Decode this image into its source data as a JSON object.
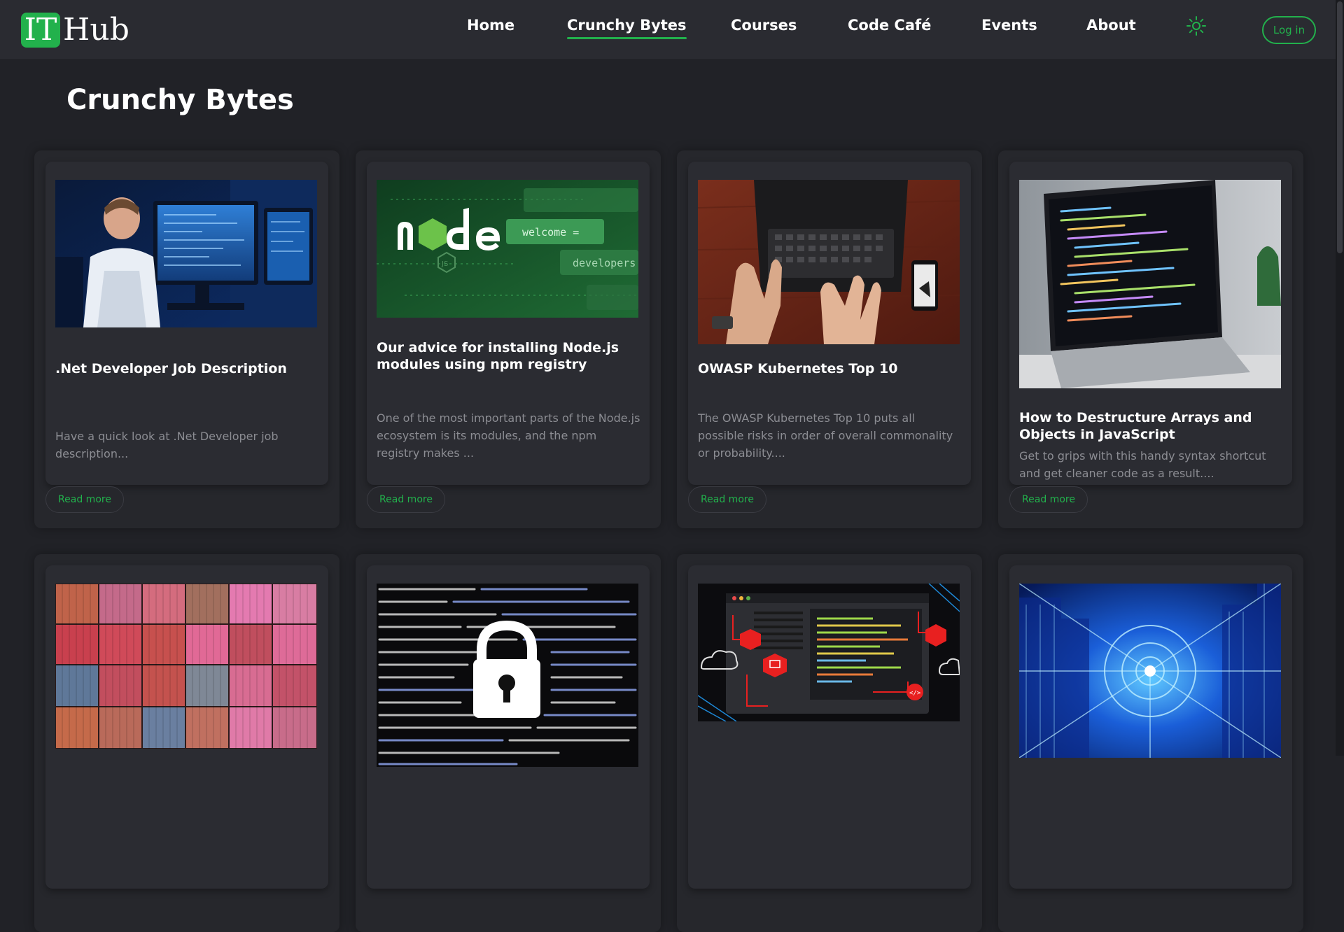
{
  "brand": {
    "badge": "IT",
    "name": "Hub",
    "accent_color": "#22b14c"
  },
  "nav": {
    "items": [
      {
        "label": "Home"
      },
      {
        "label": "Crunchy Bytes",
        "active": true
      },
      {
        "label": "Courses"
      },
      {
        "label": "Code Café"
      },
      {
        "label": "Events"
      },
      {
        "label": "About"
      }
    ],
    "theme_icon": "sun-icon",
    "login_label": "Log in"
  },
  "page": {
    "title": "Crunchy Bytes"
  },
  "cards": [
    {
      "image": "developer-monitors",
      "title": ".Net Developer Job Description",
      "description": "Have a quick look at .Net Developer job description...",
      "read_more": "Read more"
    },
    {
      "image": "nodejs-banner",
      "image_text_1": "welcome =",
      "image_text_2": "developers",
      "title": "Our advice for installing Node.js modules using npm registry",
      "description": "One of the most important parts of the Node.js ecosystem is its modules, and the npm registry makes ...",
      "read_more": "Read more"
    },
    {
      "image": "laptop-topdown",
      "title": "OWASP Kubernetes Top 10",
      "description": "The OWASP Kubernetes Top 10 puts all possible risks in order of overall commonality or probability....",
      "read_more": "Read more"
    },
    {
      "image": "laptop-code",
      "title": "How to Destructure Arrays and Objects in JavaScript",
      "description": "Get to grips with this handy syntax shortcut and get cleaner code as a result....",
      "read_more": "Read more"
    },
    {
      "image": "shipping-containers"
    },
    {
      "image": "code-padlock"
    },
    {
      "image": "devops-pipeline"
    },
    {
      "image": "blue-tech-city"
    }
  ]
}
